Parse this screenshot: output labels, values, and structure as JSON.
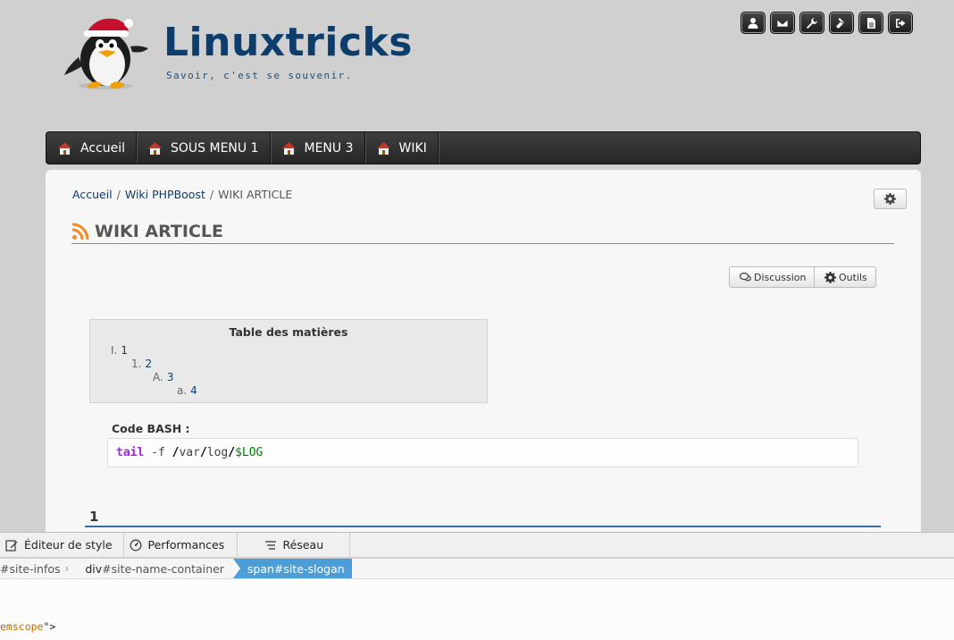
{
  "header": {
    "site_name": "Linuxtricks",
    "slogan": "Savoir, c'est se souvenir.",
    "user_toolbar": [
      "user-icon",
      "envelope-icon",
      "wrench-icon",
      "gavel-icon",
      "file-icon",
      "logout-icon"
    ]
  },
  "menu": {
    "items": [
      {
        "label": "Accueil"
      },
      {
        "label": "SOUS MENU 1"
      },
      {
        "label": "MENU 3"
      },
      {
        "label": "WIKI"
      }
    ]
  },
  "breadcrumb": {
    "items": [
      "Accueil",
      "Wiki PHPBoost"
    ],
    "separator": "/",
    "current": "WIKI ARTICLE"
  },
  "page": {
    "title": "WIKI ARTICLE"
  },
  "wiki_tools": {
    "discussion_label": "Discussion",
    "tools_label": "Outils"
  },
  "toc": {
    "title": "Table des matières",
    "entries": [
      {
        "num": "I.",
        "label": "1"
      },
      {
        "num": "1.",
        "label": "2"
      },
      {
        "num": "A.",
        "label": "3"
      },
      {
        "num": "a.",
        "label": "4"
      }
    ]
  },
  "code": {
    "label": "Code BASH :",
    "tokens": {
      "cmd": "tail",
      "opt": "-f",
      "s1": "/",
      "p1": "var",
      "s2": "/",
      "p2": "log",
      "s3": "/",
      "var": "$LOG"
    }
  },
  "section": {
    "heading": "1"
  },
  "devtools": {
    "tabs": [
      "Éditeur de style",
      "Performances",
      "Réseau"
    ],
    "breadcrumbs": [
      {
        "pre": "",
        "hl": "",
        "rest": "#site-infos"
      },
      {
        "pre": "",
        "hl": "div",
        "rest": "#site-name-container"
      }
    ],
    "active_crumb": "span#site-slogan",
    "markup_attr": "emscope",
    "markup_tail": "\">"
  },
  "colors": {
    "menu_bg": "#2f2f2f",
    "link": "#0d3d6b",
    "code_keyword": "#a020f0",
    "code_variable": "#008000",
    "section_underline": "#3c6ea0",
    "devtools_active": "#4c9ed9"
  }
}
